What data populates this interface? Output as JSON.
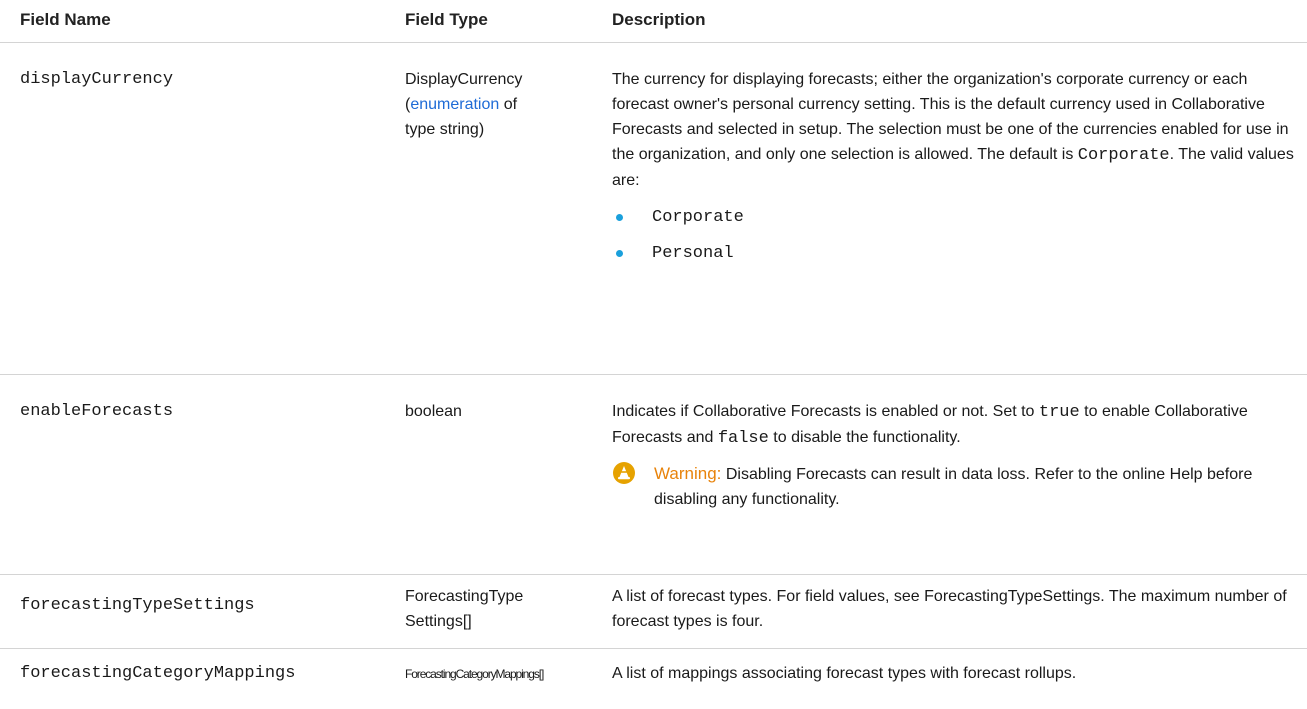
{
  "headers": {
    "field_name": "Field Name",
    "field_type": "Field Type",
    "description": "Description"
  },
  "rows": [
    {
      "name": "displayCurrency",
      "type_line1": "DisplayCurrency",
      "type_paren_open": "(",
      "type_link": "enumeration",
      "type_after_link": " of",
      "type_line3": "type string)",
      "desc_text1": "The currency for displaying forecasts; either the organization's corporate currency or each forecast owner's personal currency setting. This is the default currency used in Collaborative Forecasts and selected in setup. The selection must be one of the currencies enabled for use in the organization, and only one selection is allowed. The default is ",
      "desc_code": "Corporate",
      "desc_text2": ". The valid values are:",
      "values": [
        "Corporate",
        "Personal"
      ]
    },
    {
      "name": "enableForecasts",
      "type": "boolean",
      "desc_text1": "Indicates if Collaborative Forecasts is enabled or not. Set to ",
      "desc_code1": "true",
      "desc_text2": " to enable Collaborative Forecasts and ",
      "desc_code2": "false",
      "desc_text3": " to disable the functionality.",
      "warning_label": "Warning:",
      "warning_text": " Disabling Forecasts can result in data loss. Refer to the online Help before disabling any functionality.",
      "warning_icon": "warning-cone-icon",
      "warning_color": "#e8830b"
    },
    {
      "name": "forecastingTypeSettings",
      "type_line1": "ForecastingType",
      "type_line2": "Settings[]",
      "desc": "A list of forecast types. For field values, see ForecastingTypeSettings. The maximum number of forecast types is four."
    },
    {
      "name": "forecastingCategoryMappings",
      "type": "ForecastingCategoryMappings[]",
      "desc": "A list of mappings associating forecast types with forecast rollups."
    }
  ],
  "colors": {
    "link": "#1e6bd6",
    "bullet": "#1aa0dc",
    "divider": "#d4d4d4"
  }
}
